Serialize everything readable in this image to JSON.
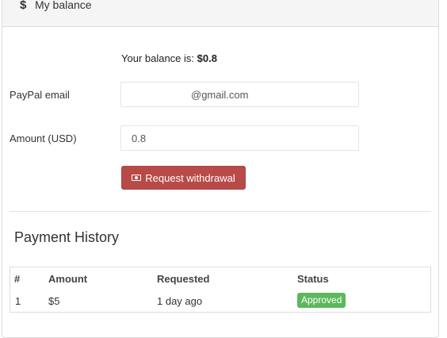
{
  "header": {
    "icon": "dollar-icon",
    "icon_glyph": "$",
    "title": "My balance"
  },
  "balance": {
    "label": "Your balance is: ",
    "value": "$0.8"
  },
  "form": {
    "email_label": "PayPal email",
    "email_value": "@gmail.com",
    "amount_label": "Amount (USD)",
    "amount_value": "0.8",
    "withdraw_button": "Request withdrawal",
    "withdraw_icon": "money-icon"
  },
  "history": {
    "title": "Payment History",
    "columns": [
      "#",
      "Amount",
      "Requested",
      "Status"
    ],
    "rows": [
      {
        "num": "1",
        "amount": "$5",
        "requested": "1 day ago",
        "status": "Approved"
      }
    ]
  },
  "colors": {
    "danger_button": "#b84a48",
    "approved_badge": "#5cb85c",
    "heading_bg": "#f5f5f5"
  }
}
